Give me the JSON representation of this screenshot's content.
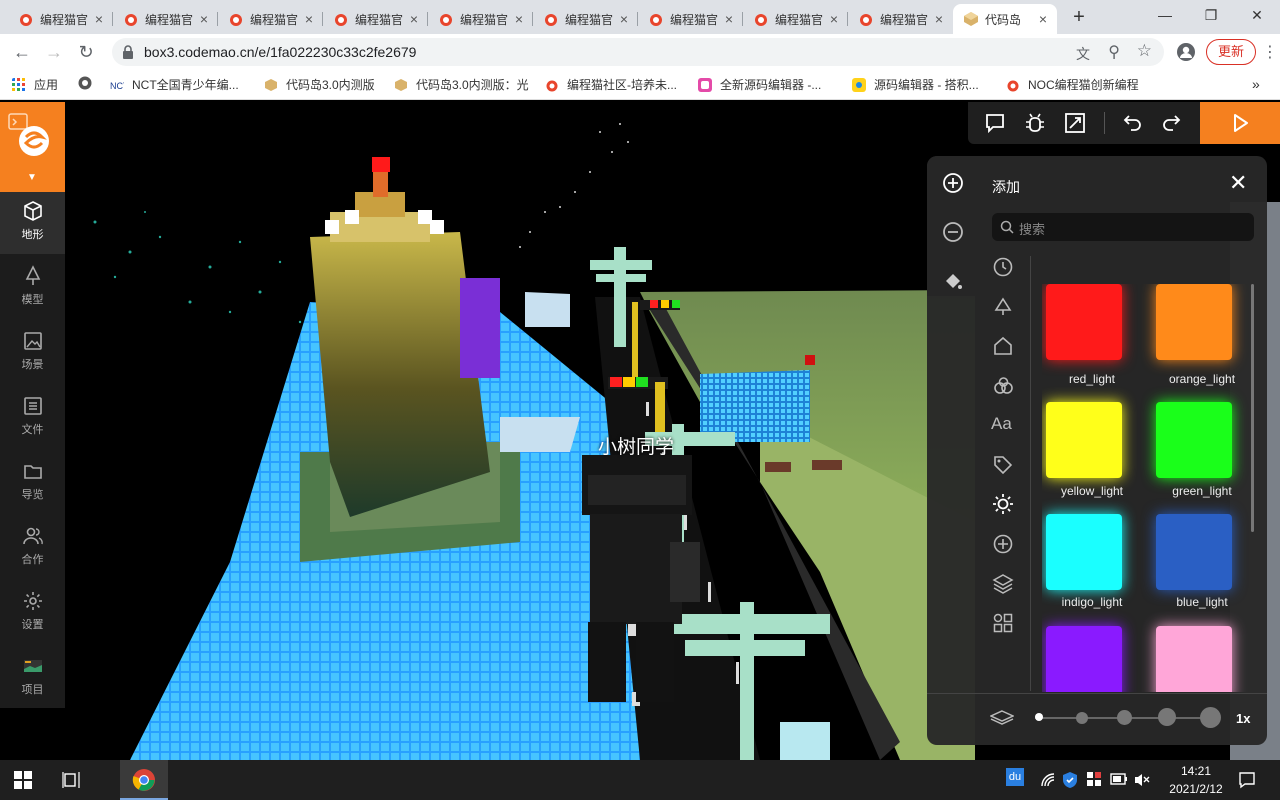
{
  "browser": {
    "tabs": [
      {
        "title": "编程猫官"
      },
      {
        "title": "编程猫官"
      },
      {
        "title": "编程猫官"
      },
      {
        "title": "编程猫官"
      },
      {
        "title": "编程猫官"
      },
      {
        "title": "编程猫官"
      },
      {
        "title": "编程猫官"
      },
      {
        "title": "编程猫官"
      },
      {
        "title": "编程猫官"
      },
      {
        "title": "代码岛"
      }
    ],
    "new_tab": "+",
    "url": "box3.codemao.cn/e/1fa022230c33c2fe2679",
    "update_button": "更新",
    "bookmarks": [
      {
        "label": "应用"
      },
      {
        "label": ""
      },
      {
        "label": "NCT全国青少年编..."
      },
      {
        "label": "代码岛3.0内测版"
      },
      {
        "label": "代码岛3.0内测版：光"
      },
      {
        "label": "编程猫社区-培养未..."
      },
      {
        "label": "全新源码编辑器 -..."
      },
      {
        "label": "源码编辑器 - 搭积..."
      },
      {
        "label": "NOC编程猫创新编程"
      }
    ],
    "more": "»"
  },
  "sidebar": {
    "items": [
      {
        "label": "地形",
        "icon": "cube-icon"
      },
      {
        "label": "模型",
        "icon": "tree-icon"
      },
      {
        "label": "场景",
        "icon": "image-icon"
      },
      {
        "label": "文件",
        "icon": "list-icon"
      },
      {
        "label": "导览",
        "icon": "folder-icon"
      },
      {
        "label": "合作",
        "icon": "users-icon"
      },
      {
        "label": "设置",
        "icon": "gear-icon"
      },
      {
        "label": "项目",
        "icon": "project-icon"
      }
    ]
  },
  "scene": {
    "player_name": "小树同学"
  },
  "panel": {
    "title": "添加",
    "search_placeholder": "搜索",
    "blocks": [
      {
        "name": "red_light",
        "color": "#ff1a1a"
      },
      {
        "name": "orange_light",
        "color": "#ff8a1a"
      },
      {
        "name": "yellow_light",
        "color": "#ffff1a"
      },
      {
        "name": "green_light",
        "color": "#1aff1a"
      },
      {
        "name": "indigo_light",
        "color": "#1affff"
      },
      {
        "name": "blue_light",
        "color": "#2a5fc4"
      },
      {
        "name": "",
        "color": "#8a1aff"
      },
      {
        "name": "",
        "color": "#ffa6d8"
      }
    ],
    "zoom_label": "1x"
  },
  "taskbar": {
    "time": "14:21",
    "date": "2021/2/12"
  },
  "colors": {
    "accent": "#f5801f"
  }
}
